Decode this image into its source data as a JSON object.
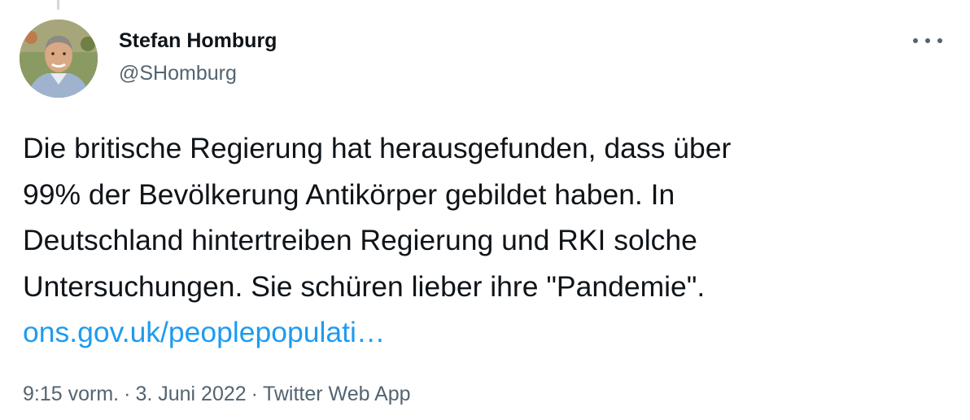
{
  "tweet": {
    "author": {
      "display_name": "Stefan Homburg",
      "handle": "@SHomburg",
      "avatar": "profile-photo"
    },
    "more_icon": "more-horizontal-icon",
    "text_lines": [
      "Die britische Regierung hat herausgefunden, dass über",
      "99% der Bevölkerung Antikörper gebildet haben. In",
      "Deutschland hintertreiben Regierung und RKI solche",
      "Untersuchungen. Sie schüren lieber ihre \"Pandemie\"."
    ],
    "link_text": "ons.gov.uk/peoplepopulati…",
    "time": "9:15 vorm.",
    "separator": "·",
    "date": "3. Juni 2022",
    "source": "Twitter Web App"
  },
  "colors": {
    "text": "#0f1419",
    "secondary": "#536471",
    "link": "#1d9bf0",
    "thread_line": "#cfd9de"
  }
}
